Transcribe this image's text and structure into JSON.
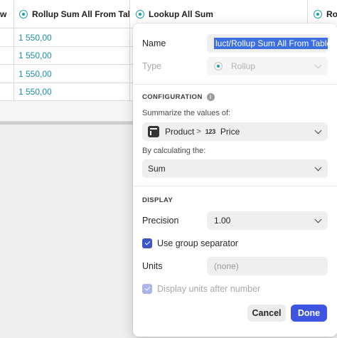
{
  "grid": {
    "columns": [
      {
        "label": "w",
        "icon": ""
      },
      {
        "label": "Rollup Sum All From Table",
        "icon": "rollup-icon"
      },
      {
        "label": "Lookup All Sum",
        "icon": "lookup-icon"
      },
      {
        "label": "Rol",
        "icon": "rollup-icon"
      }
    ],
    "rows": [
      "1 550,00",
      "1 550,00",
      "1 550,00",
      "1 550,00"
    ]
  },
  "panel": {
    "name_label": "Name",
    "name_value": "luct/Rollup Sum All From Table",
    "type_label": "Type",
    "type_value": "Rollup",
    "configuration_title": "CONFIGURATION",
    "info_glyph": "i",
    "summarize_label": "Summarize the values of:",
    "path": {
      "table": "Product",
      "separator": ">",
      "number_glyph": "123",
      "field": "Price"
    },
    "calc_label": "By calculating the:",
    "calc_value": "Sum",
    "display_title": "DISPLAY",
    "precision_label": "Precision",
    "precision_value": "1.00",
    "group_separator_label": "Use group separator",
    "group_separator_checked": true,
    "units_label": "Units",
    "units_placeholder": "(none)",
    "units_after_label": "Display units after number",
    "cancel_label": "Cancel",
    "done_label": "Done"
  },
  "colors": {
    "accent": "#3d55e0",
    "link": "#1a8fa0",
    "selection": "#3d6fe0"
  }
}
